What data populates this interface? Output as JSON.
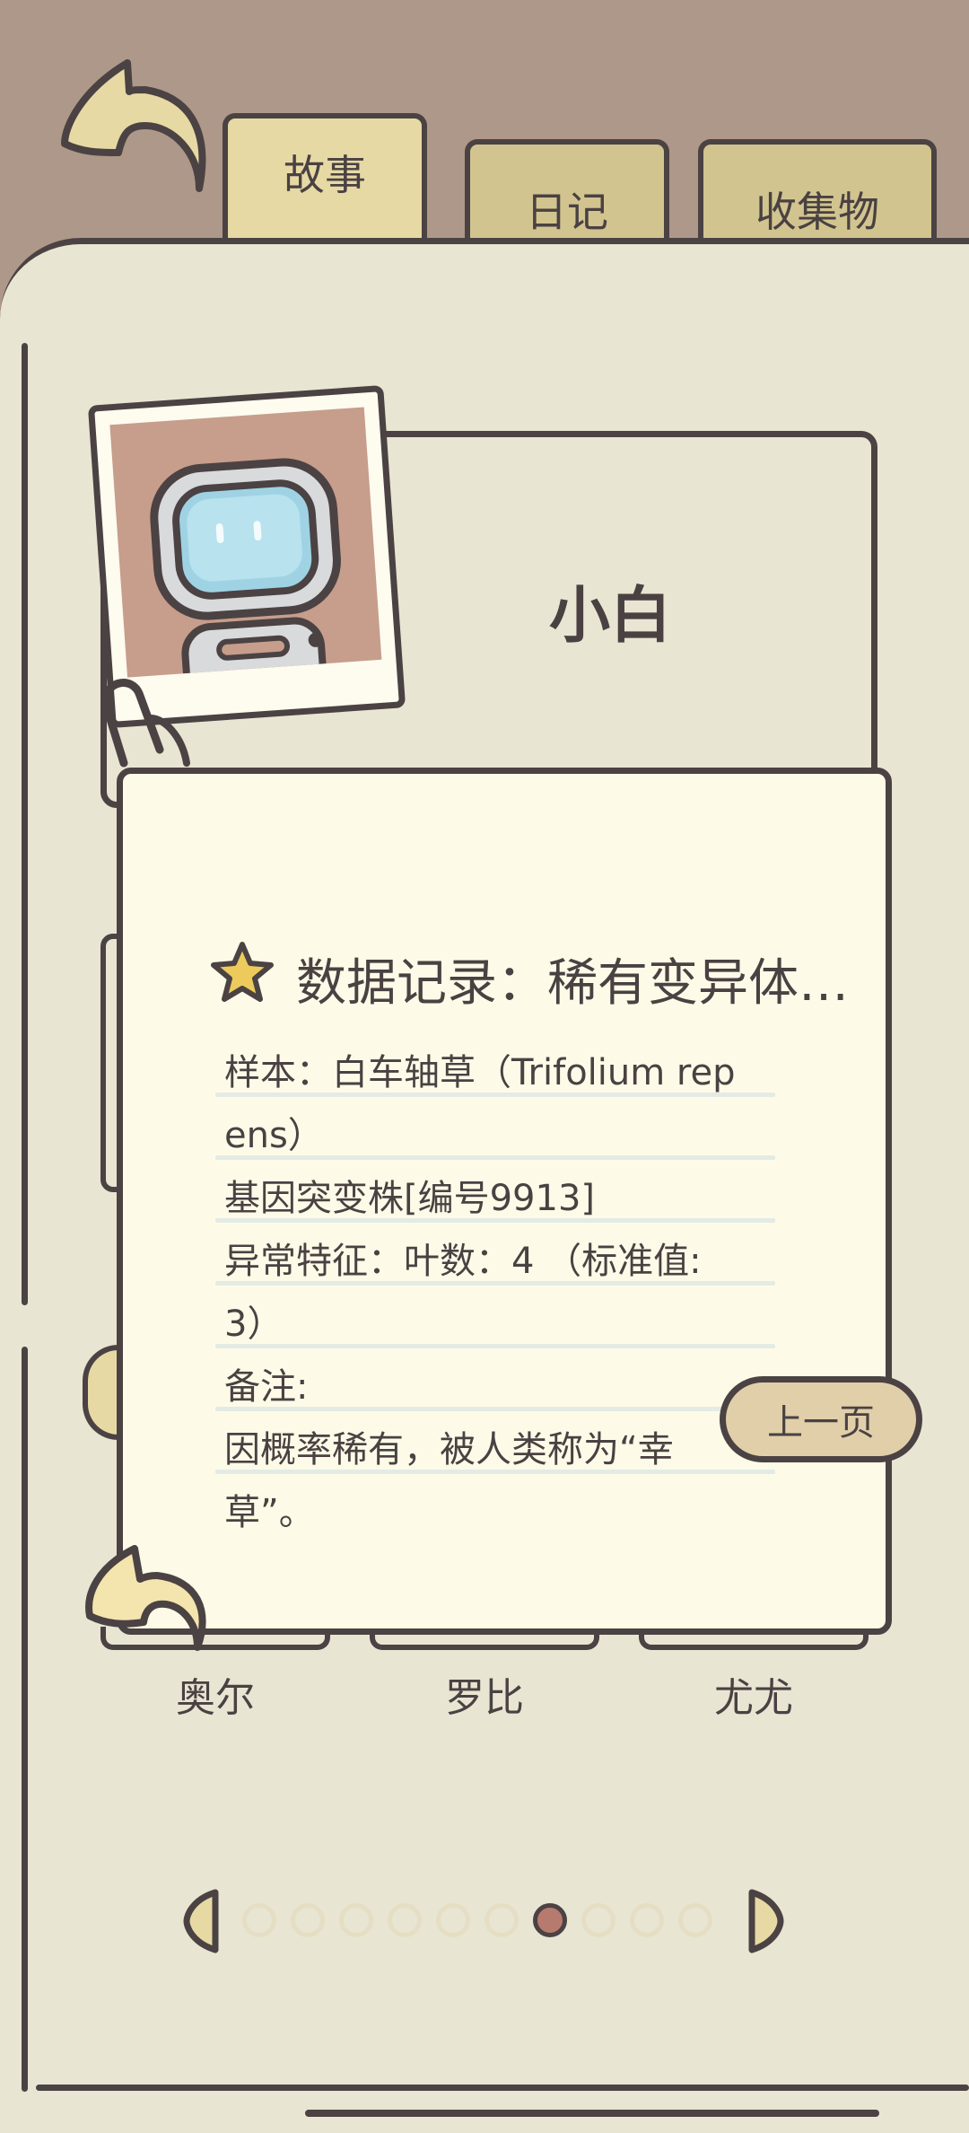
{
  "tabs": [
    {
      "label": "故事",
      "active": true
    },
    {
      "label": "日记",
      "active": false
    },
    {
      "label": "收集物",
      "active": false
    }
  ],
  "character": {
    "name": "小白",
    "avatar_icon": "robot-icon"
  },
  "note": {
    "title": "数据记录：稀有变异体…",
    "title_icon": "star-icon",
    "lines": [
      "样本：白车轴草（Trifolium rep",
      "ens）",
      "基因突变株[编号9913]",
      "异常特征：叶数：4 （标准值:",
      "3）",
      "备注:",
      "因概率稀有，被人类称为“幸",
      "草”。"
    ]
  },
  "prev_button": {
    "label": "上一页"
  },
  "characters_row": [
    "奥尔",
    "罗比",
    "尤尤"
  ],
  "pagination": {
    "total": 10,
    "current": 7
  },
  "colors": {
    "outline": "#4b4243",
    "page": "#e8e5d3",
    "note": "#fdfbe8",
    "tab": "#e7d9a4",
    "header_bg": "#ae9889",
    "dot_active": "#b67b6e"
  }
}
